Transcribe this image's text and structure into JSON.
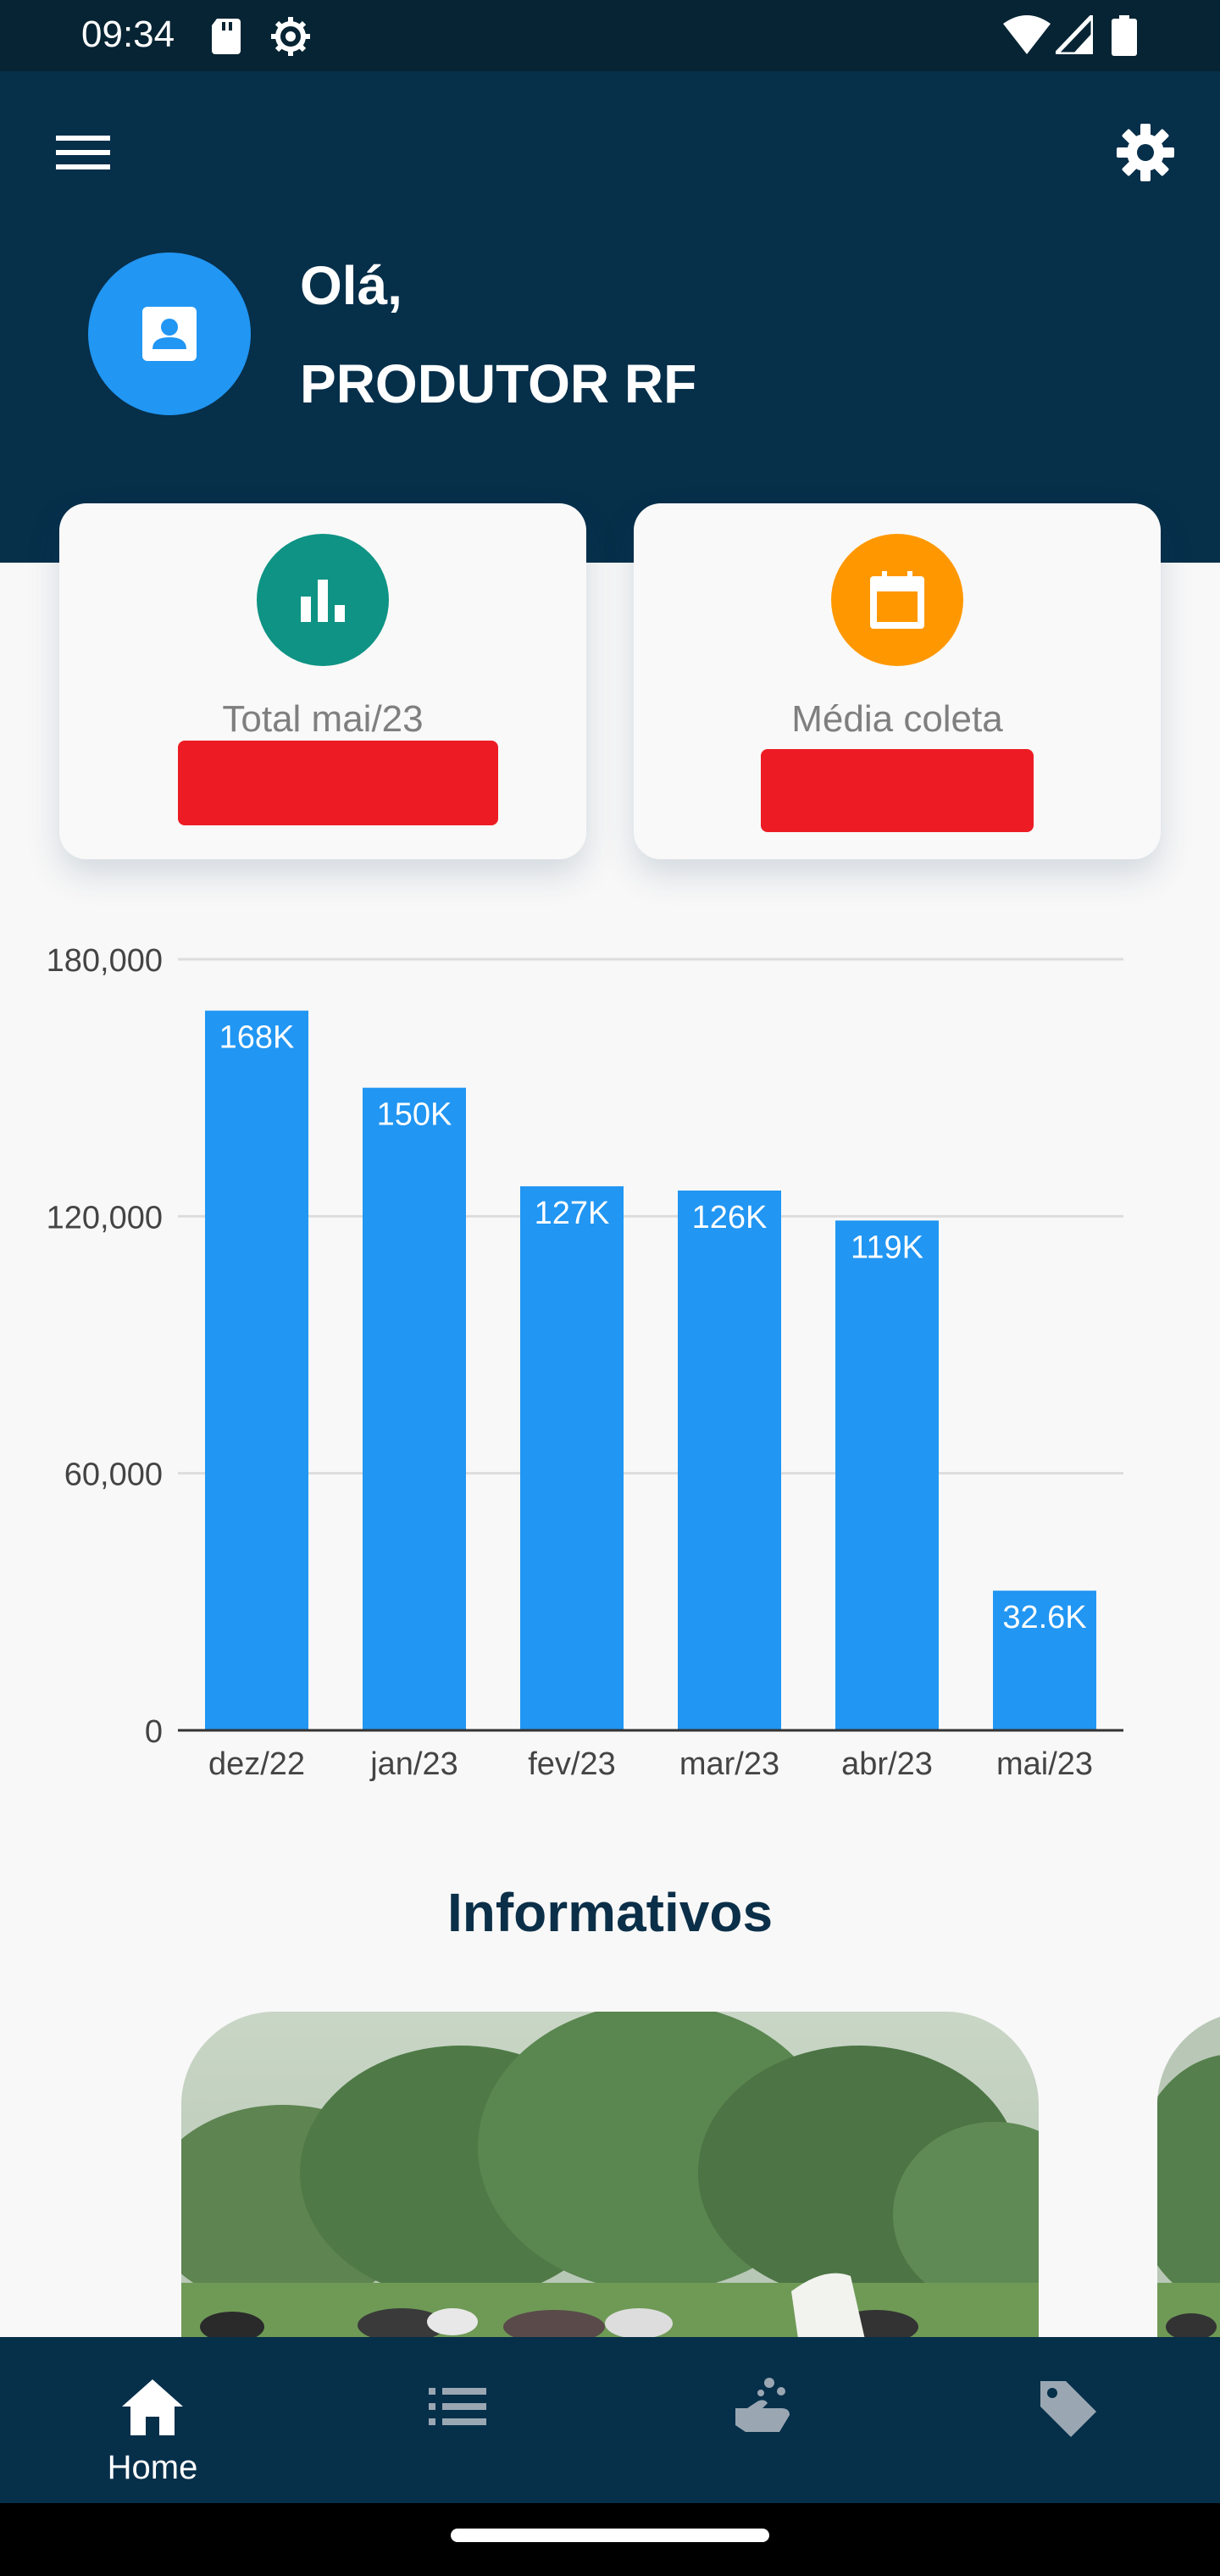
{
  "status_bar": {
    "time": "09:34",
    "icons": [
      "sd-card-icon",
      "settings-cog-icon",
      "wifi-icon",
      "signal-icon",
      "battery-icon"
    ]
  },
  "header": {
    "greeting": "Olá,",
    "producer_name": "PRODUTOR RF",
    "menu_icon": "menu-icon",
    "settings_icon": "gear-icon",
    "avatar_icon": "contact-card-icon"
  },
  "cards": {
    "total": {
      "title": "Total mai/23",
      "icon": "bar-chart-icon",
      "icon_color": "#0e9384"
    },
    "media": {
      "title": "Média coleta",
      "icon": "calendar-icon",
      "icon_color": "#ff9800"
    }
  },
  "chart_data": {
    "type": "bar",
    "categories": [
      "dez/22",
      "jan/23",
      "fev/23",
      "mar/23",
      "abr/23",
      "mai/23"
    ],
    "values": [
      168000,
      150000,
      127000,
      126000,
      119000,
      32600
    ],
    "data_labels": [
      "168K",
      "150K",
      "127K",
      "126K",
      "119K",
      "32.6K"
    ],
    "y_ticks": [
      "0",
      "60,000",
      "120,000",
      "180,000"
    ],
    "ylim": [
      0,
      180000
    ],
    "grid": true,
    "bar_color": "#2196f3"
  },
  "informativos": {
    "title": "Informativos"
  },
  "bottom_nav": {
    "items": [
      {
        "label": "Home",
        "icon": "home-icon",
        "active": true
      },
      {
        "label": "",
        "icon": "list-icon",
        "active": false
      },
      {
        "label": "",
        "icon": "hand-wash-icon",
        "active": false
      },
      {
        "label": "",
        "icon": "tag-icon",
        "active": false
      }
    ]
  },
  "colors": {
    "primary_dark": "#062f4a",
    "accent_blue": "#2196f3",
    "redacted": "#ed1c24"
  }
}
